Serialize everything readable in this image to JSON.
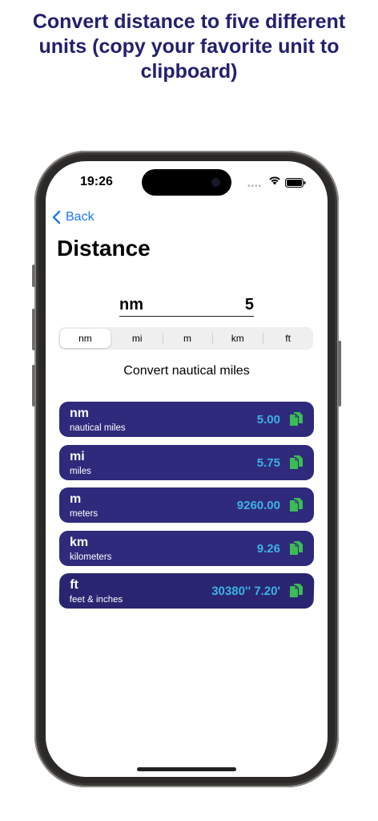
{
  "headline": {
    "line1": "Convert distance to five different",
    "line2": "units (copy your favorite unit to",
    "line3": "clipboard)"
  },
  "status_bar": {
    "time": "19:26"
  },
  "nav": {
    "back_label": "Back",
    "title": "Distance"
  },
  "input": {
    "unit": "nm",
    "value": "5"
  },
  "segments": [
    "nm",
    "mi",
    "m",
    "km",
    "ft"
  ],
  "selected_segment": "nm",
  "subtitle": "Convert nautical miles",
  "results": [
    {
      "abbr": "nm",
      "name": "nautical miles",
      "value": "5.00"
    },
    {
      "abbr": "mi",
      "name": "miles",
      "value": "5.75"
    },
    {
      "abbr": "m",
      "name": "meters",
      "value": "9260.00"
    },
    {
      "abbr": "km",
      "name": "kilometers",
      "value": "9.26"
    },
    {
      "abbr": "ft",
      "name": "feet & inches",
      "value": "30380'' 7.20'"
    }
  ],
  "colors": {
    "headline": "#23206e",
    "card_background": "#2f2a7c",
    "value_text": "#3cb2e6",
    "copy_icon": "#3dbb54",
    "accent": "#1a7bf2"
  },
  "icons": {
    "back": "chevron-left-icon",
    "copy": "copy-icon",
    "wifi": "wifi-icon",
    "battery": "battery-icon"
  }
}
